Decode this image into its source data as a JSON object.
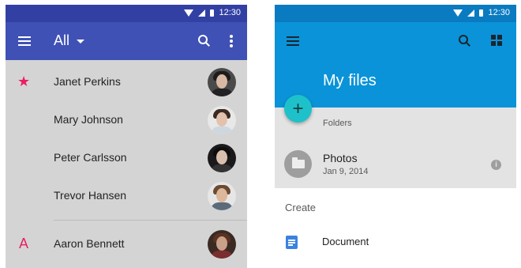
{
  "colors": {
    "left_toolbar": "#3f51b5",
    "right_appbar": "#0a93d8",
    "accent_pink": "#e91e63",
    "fab": "#1ec1c9",
    "doc_blue": "#3b82e0"
  },
  "contacts_screen": {
    "status_time": "12:30",
    "filter_label": "All",
    "contacts": [
      {
        "name": "Janet Perkins",
        "marker": "★",
        "marker_type": "star-icon"
      },
      {
        "name": "Mary Johnson",
        "marker": ""
      },
      {
        "name": "Peter Carlsson",
        "marker": ""
      },
      {
        "name": "Trevor Hansen",
        "marker": ""
      },
      {
        "name": "Aaron Bennett",
        "marker": "A",
        "marker_type": "letter-index"
      }
    ]
  },
  "files_screen": {
    "status_time": "12:30",
    "title": "My files",
    "fab_label": "+",
    "folders_label": "Folders",
    "folders": [
      {
        "name": "Photos",
        "date": "Jan 9, 2014",
        "info": "i"
      }
    ],
    "sheet": {
      "title": "Create",
      "items": [
        {
          "label": "Document",
          "icon": "document-icon"
        }
      ]
    }
  }
}
